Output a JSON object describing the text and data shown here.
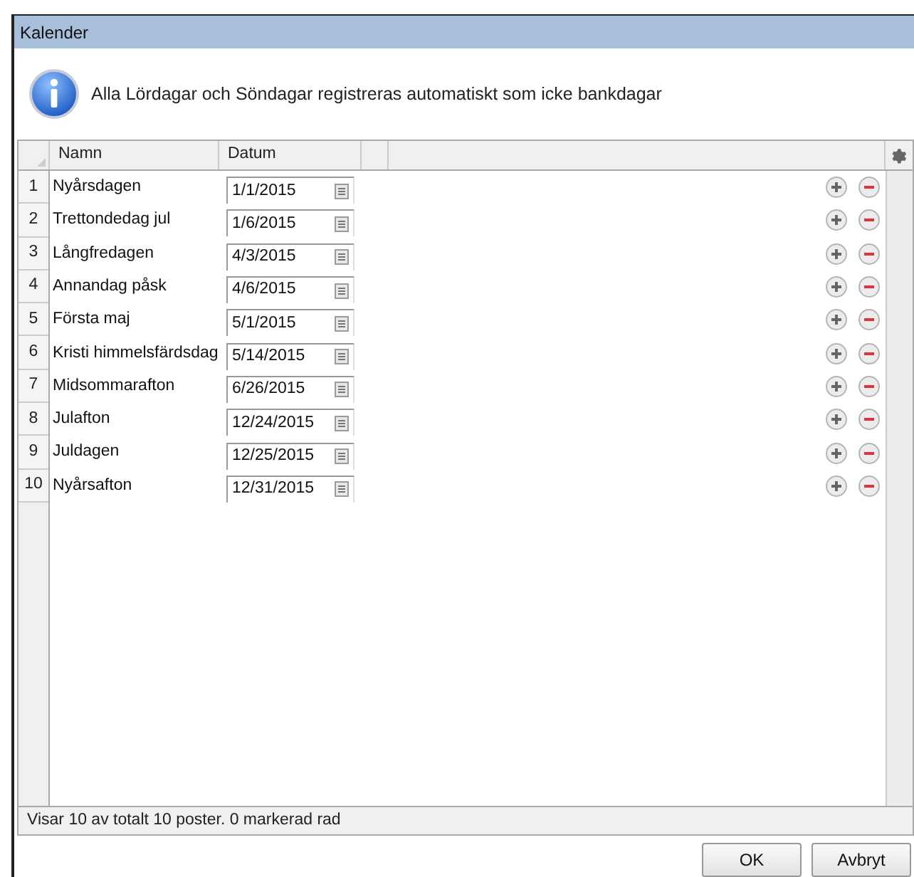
{
  "window": {
    "title": "Kalender"
  },
  "info": {
    "message": "Alla Lördagar och Söndagar registreras automatiskt som icke bankdagar"
  },
  "table": {
    "columns": [
      "Namn",
      "Datum"
    ],
    "rows": [
      {
        "number": "1",
        "name": "Nyårsdagen",
        "date": "1/1/2015"
      },
      {
        "number": "2",
        "name": "Trettondedag jul",
        "date": "1/6/2015"
      },
      {
        "number": "3",
        "name": "Långfredagen",
        "date": "4/3/2015"
      },
      {
        "number": "4",
        "name": "Annandag påsk",
        "date": "4/6/2015"
      },
      {
        "number": "5",
        "name": "Första maj",
        "date": "5/1/2015"
      },
      {
        "number": "6",
        "name": "Kristi himmelsfärdsdag",
        "date": "5/14/2015"
      },
      {
        "number": "7",
        "name": "Midsommarafton",
        "date": "6/26/2015"
      },
      {
        "number": "8",
        "name": "Julafton",
        "date": "12/24/2015"
      },
      {
        "number": "9",
        "name": "Juldagen",
        "date": "12/25/2015"
      },
      {
        "number": "10",
        "name": "Nyårsafton",
        "date": "12/31/2015"
      }
    ]
  },
  "status_bar": "Visar 10 av totalt 10 poster. 0 markerad rad",
  "buttons": [
    "OK",
    "Avbryt"
  ]
}
